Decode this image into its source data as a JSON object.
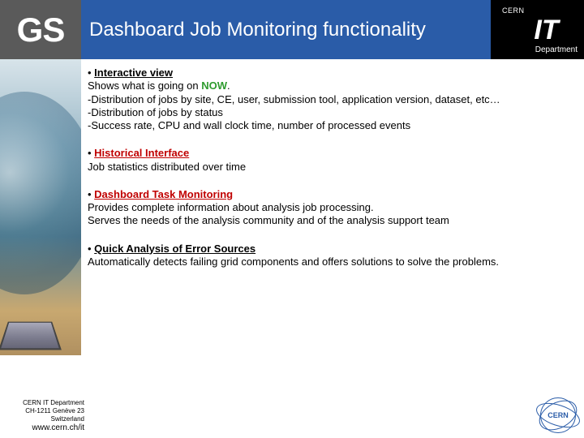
{
  "header": {
    "gs": "GS",
    "title": "Dashboard Job Monitoring functionality",
    "logo": {
      "org": "CERN",
      "unit": "IT",
      "dept": "Department"
    }
  },
  "sections": [
    {
      "head": "Interactive view",
      "head_color": "black",
      "lines": [
        {
          "pre": " Shows what is going on ",
          "now": "NOW",
          "post": "."
        },
        "-Distribution of jobs by site, CE, user, submission tool, application version, dataset, etc…",
        "-Distribution of jobs by status",
        "-Success rate, CPU and wall clock time, number of processed events"
      ]
    },
    {
      "head": "Historical Interface",
      "head_color": "red",
      "lines": [
        "   Job statistics distributed over time"
      ]
    },
    {
      "head": "Dashboard Task Monitoring",
      "head_color": "red",
      "lines": [
        "   Provides complete information about analysis job  processing.",
        "   Serves the needs of the analysis community and of the analysis support team"
      ]
    },
    {
      "head": "Quick Analysis of Error Sources",
      "head_color": "black",
      "lines": [
        "   Automatically detects failing grid components and offers solutions to solve the problems."
      ]
    }
  ],
  "footer": {
    "l1": "CERN IT Department",
    "l2": "CH-1211 Genève 23",
    "l3": "Switzerland",
    "site": "www.cern.ch/it"
  },
  "badge": "CERN"
}
